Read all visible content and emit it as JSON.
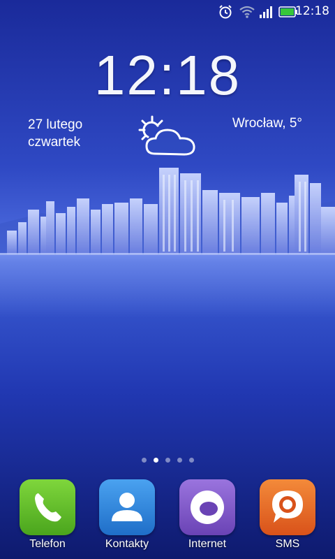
{
  "status_bar": {
    "time": "12:18",
    "icons": [
      "alarm-icon",
      "wifi-icon",
      "signal-icon",
      "battery-icon"
    ],
    "battery_color": "#37c63b"
  },
  "lock_widget": {
    "clock": "12:18",
    "date": "27 lutego",
    "weekday": "czwartek",
    "location_temp": "Wrocław, 5°",
    "weather_icon": "partly-cloudy-icon"
  },
  "home": {
    "pages": 5,
    "active_page": 2
  },
  "dock": {
    "apps": [
      {
        "label": "Telefon",
        "icon": "phone-icon",
        "color": "#59b82a"
      },
      {
        "label": "Kontakty",
        "icon": "contact-icon",
        "color": "#2f83d8"
      },
      {
        "label": "Internet",
        "icon": "browser-icon",
        "color": "#7e55c5"
      },
      {
        "label": "SMS",
        "icon": "message-icon",
        "color": "#e8661d"
      }
    ]
  }
}
